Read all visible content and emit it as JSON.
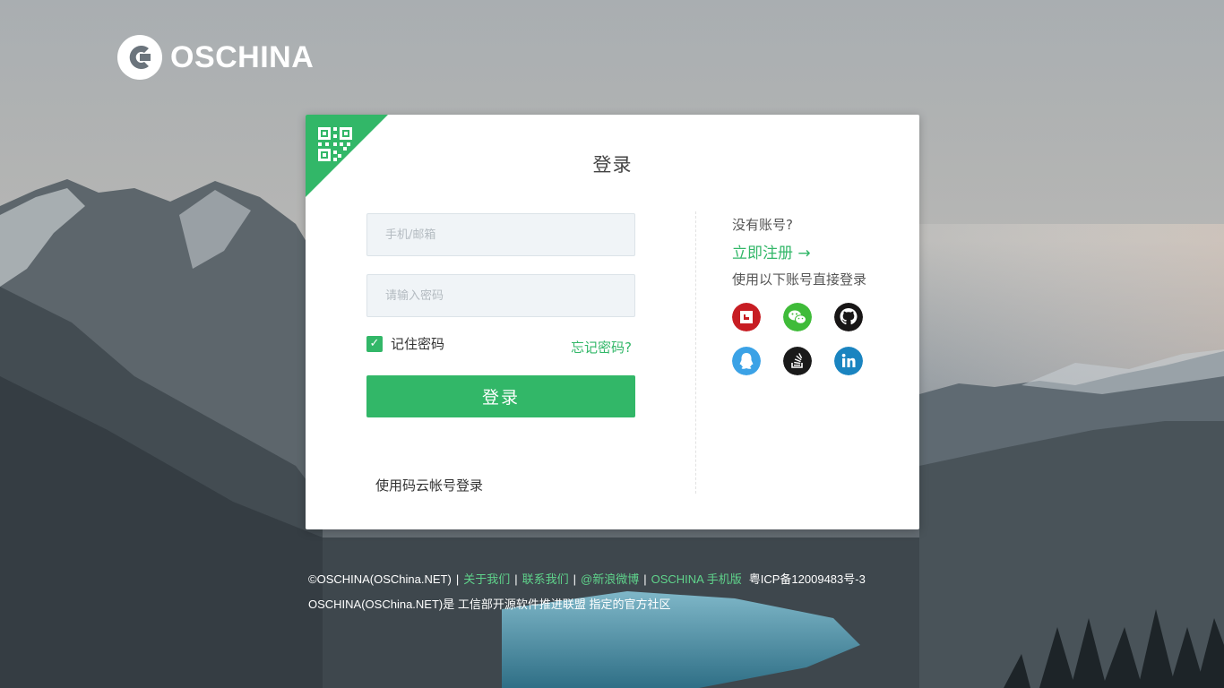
{
  "brand": {
    "name": "OSCHINA",
    "color_primary": "#32b768"
  },
  "login": {
    "title": "登录",
    "username_placeholder": "手机/邮箱",
    "password_placeholder": "请输入密码",
    "remember_label": "记住密码",
    "remember_checked": true,
    "check_mark": "✓",
    "forgot_label": "忘记密码?",
    "submit_label": "登录",
    "gitee_login_label": "使用码云帐号登录",
    "qr_icon": "qrcode-icon"
  },
  "side": {
    "no_account": "没有账号?",
    "register_label": "立即注册 →",
    "third_party_title": "使用以下账号直接登录",
    "providers": [
      {
        "name": "gitee",
        "icon": "gitee-icon",
        "color": "#c71d23"
      },
      {
        "name": "wechat",
        "icon": "wechat-icon",
        "color": "#3fbb39"
      },
      {
        "name": "github",
        "icon": "github-icon",
        "color": "#181616"
      },
      {
        "name": "qq",
        "icon": "qq-icon",
        "color": "#3ba2e6"
      },
      {
        "name": "stackoverflow",
        "icon": "stackoverflow-icon",
        "color": "#1a1a1a"
      },
      {
        "name": "linkedin",
        "icon": "linkedin-icon",
        "color": "#1a84c0"
      }
    ]
  },
  "footer": {
    "copyright": "©OSCHINA(OSChina.NET)",
    "links": [
      "关于我们",
      "联系我们",
      "@新浪微博",
      "OSCHINA 手机版"
    ],
    "icp": "粤ICP备12009483号-3",
    "line2_prefix": "OSCHINA(OSChina.NET)是",
    "line2_org": "工信部开源软件推进联盟",
    "line2_suffix": "指定的官方社区",
    "separator": "|"
  }
}
